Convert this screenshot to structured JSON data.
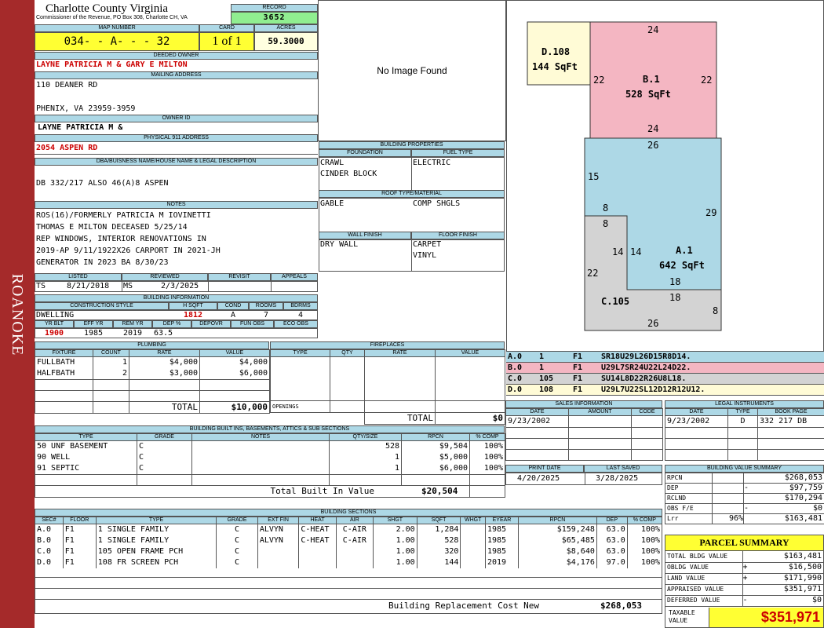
{
  "side_label": "ROANOKE",
  "county": {
    "title": "Charlotte County Virginia",
    "subtitle": "Commissioner of the Revenue, PO Box 308, Charlotte CH, VA"
  },
  "record": {
    "label": "RECORD",
    "value": "3652"
  },
  "map": {
    "label": "MAP NUMBER",
    "value": "034- - A- - - 32"
  },
  "card": {
    "label": "CARD",
    "value": "1 of 1"
  },
  "acres": {
    "label": "ACRES",
    "value": "59.3000"
  },
  "deeded_owner": {
    "label": "DEEDED OWNER",
    "value": "LAYNE PATRICIA M & GARY E MILTON"
  },
  "mailing": {
    "label": "MAILING ADDRESS",
    "line1": "110 DEANER RD",
    "line2": "",
    "line3": "PHENIX, VA 23959-3959"
  },
  "owner_id": {
    "label": "OWNER ID",
    "value": "LAYNE PATRICIA M &"
  },
  "physical": {
    "label": "PHYSICAL 911 ADDRESS",
    "value": "2054 ASPEN RD"
  },
  "dba": {
    "label": "DBA/BUISNESS NAME/HOUSE NAME & LEGAL DESCRIPTION",
    "value": "DB 332/217 ALSO 46(A)8 ASPEN"
  },
  "notes": {
    "label": "NOTES",
    "lines": [
      "ROS(16)/FORMERLY PATRICIA M IOVINETTI",
      "THOMAS E MILTON DECEASED 5/25/14",
      "REP WINDOWS, INTERIOR RENOVATIONS IN",
      "2019-AP 9/11/1922X26 CARPORT IN 2021-JH",
      "GENERATOR IN 2023 BA 8/30/23"
    ]
  },
  "listed": {
    "label": "LISTED",
    "by": "TS",
    "date": "8/21/2018"
  },
  "reviewed": {
    "label": "REVIEWED",
    "by": "MS",
    "date": "2/3/2025"
  },
  "revisit": {
    "label": "REVISIT",
    "value": ""
  },
  "appeals": {
    "label": "APPEALS",
    "value": ""
  },
  "bldg_info": {
    "label": "BUILDING INFORMATION",
    "headers": [
      "CONSTRUCTION STYLE",
      "H SQFT",
      "COND",
      "ROOMS",
      "BDRMS"
    ],
    "style": "DWELLING",
    "hsqft": "1812",
    "cond": "A",
    "rooms": "7",
    "bdrms": "4",
    "headers2": [
      "YR BLT",
      "EFF YR",
      "REM YR",
      "DEP %",
      "DEPOVR",
      "FUN OBS",
      "ECO OBS"
    ],
    "yrblt": "1900",
    "effyr": "1985",
    "remyr": "2019",
    "dep": "63.5",
    "depovr": "",
    "funobs": "",
    "ecoobs": ""
  },
  "no_image": "No Image Found",
  "building_properties": {
    "label": "BUILDING PROPERTIES",
    "foundation_label": "FOUNDATION",
    "foundation": [
      "CRAWL",
      "CINDER BLOCK"
    ],
    "fuel_label": "FUEL TYPE",
    "fuel": "ELECTRIC",
    "roof_label": "ROOF TYPE/MATERIAL",
    "roof_type": "GABLE",
    "roof_material": "COMP SHGLS",
    "wall_label": "WALL FINISH",
    "wall": "DRY WALL",
    "floor_label": "FLOOR FINISH",
    "floor": [
      "CARPET",
      "VINYL"
    ]
  },
  "plumbing": {
    "label": "PLUMBING",
    "headers": [
      "FIXTURE",
      "COUNT",
      "RATE",
      "VALUE"
    ],
    "rows": [
      [
        "FULLBATH",
        "1",
        "$4,000",
        "$4,000"
      ],
      [
        "HALFBATH",
        "2",
        "$3,000",
        "$6,000"
      ]
    ],
    "total_label": "TOTAL",
    "total": "$10,000"
  },
  "fireplaces": {
    "label": "FIREPLACES",
    "headers": [
      "TYPE",
      "QTY",
      "RATE",
      "VALUE"
    ],
    "openings_label": "OPENINGS",
    "total_label": "TOTAL",
    "total": "$0"
  },
  "builtins": {
    "label": "BUILDING BUILT INS, BASEMENTS, ATTICS & SUB SECTIONS",
    "headers": [
      "TYPE",
      "GRADE",
      "NOTES",
      "QTY/SIZE",
      "RPCN",
      "% COMP"
    ],
    "rows": [
      [
        "50 UNF BASEMENT",
        "C",
        "",
        "528",
        "$9,504",
        "100%"
      ],
      [
        "90 WELL",
        "C",
        "",
        "1",
        "$5,000",
        "100%"
      ],
      [
        "91 SEPTIC",
        "C",
        "",
        "1",
        "$6,000",
        "100%"
      ]
    ],
    "total_label": "Total Built In Value",
    "total": "$20,504"
  },
  "sections": {
    "label": "BUILDING SECTIONS",
    "headers": [
      "SEC#",
      "FLOOR",
      "TYPE",
      "GRADE",
      "EXT FIN",
      "HEAT",
      "AIR",
      "SHGT",
      "SQFT",
      "WHGT",
      "EYEAR",
      "RPCN",
      "DEP",
      "% COMP"
    ],
    "rows": [
      [
        "A.0",
        "F1",
        "1 SINGLE FAMILY",
        "C",
        "ALVYN",
        "C-HEAT",
        "C-AIR",
        "2.00",
        "1,284",
        "",
        "1985",
        "$159,248",
        "63.0",
        "100%"
      ],
      [
        "B.0",
        "F1",
        "1 SINGLE FAMILY",
        "C",
        "ALVYN",
        "C-HEAT",
        "C-AIR",
        "1.00",
        "528",
        "",
        "1985",
        "$65,485",
        "63.0",
        "100%"
      ],
      [
        "C.0",
        "F1",
        "105 OPEN FRAME PCH",
        "C",
        "",
        "",
        "",
        "1.00",
        "320",
        "",
        "1985",
        "$8,640",
        "63.0",
        "100%"
      ],
      [
        "D.0",
        "F1",
        "108 FR SCREEN PCH",
        "C",
        "",
        "",
        "",
        "1.00",
        "144",
        "",
        "2019",
        "$4,176",
        "97.0",
        "100%"
      ]
    ],
    "rcn_label": "Building Replacement Cost New",
    "rcn": "$268,053"
  },
  "sketch": {
    "areas": [
      {
        "name": "D.108",
        "sqft": "144 SqFt",
        "color": "#fffbd6"
      },
      {
        "name": "B.1",
        "sqft": "528 SqFt",
        "color": "#f4b6c2"
      },
      {
        "name": "A.1",
        "sqft": "642 SqFt",
        "color": "#add8e6"
      },
      {
        "name": "C.105",
        "sqft": "",
        "color": "#d3d3d3"
      }
    ],
    "dims": [
      "24",
      "22",
      "22",
      "24",
      "26",
      "15",
      "29",
      "8",
      "8",
      "14",
      "14",
      "22",
      "18",
      "18",
      "8",
      "26"
    ]
  },
  "legend": [
    {
      "sec": "A.0",
      "n": "1",
      "f": "F1",
      "code": "SR18U29L26D15R8D14.",
      "color": "#add8e6"
    },
    {
      "sec": "B.0",
      "n": "1",
      "f": "F1",
      "code": "U29L7SR24U22L24D22.",
      "color": "#f4b6c2"
    },
    {
      "sec": "C.0",
      "n": "105",
      "f": "F1",
      "code": "SU14L8D22R26U8L18.",
      "color": "#d3d3d3"
    },
    {
      "sec": "D.0",
      "n": "108",
      "f": "F1",
      "code": "U29L7U22SL12D12R12U12.",
      "color": "#fffbd6"
    }
  ],
  "sales": {
    "label": "SALES INFORMATION",
    "headers": [
      "DATE",
      "AMOUNT",
      "CODE"
    ],
    "rows": [
      [
        "9/23/2002",
        "",
        ""
      ]
    ]
  },
  "legal": {
    "label": "LEGAL INSTRUMENTS",
    "headers": [
      "DATE",
      "TYPE",
      "BOOK PAGE"
    ],
    "rows": [
      [
        "9/23/2002",
        "D",
        "332 217 DB"
      ]
    ]
  },
  "print_date": {
    "label": "PRINT DATE",
    "value": "4/20/2025"
  },
  "last_saved": {
    "label": "LAST SAVED",
    "value": "3/28/2025"
  },
  "bvs": {
    "label": "BUILDING VALUE SUMMARY",
    "rows": [
      [
        "RPCN",
        "",
        "",
        "$268,053"
      ],
      [
        "DEP",
        "",
        "-",
        "$97,759"
      ],
      [
        "RCLND",
        "",
        "",
        "$170,294"
      ],
      [
        "OBS F/E",
        "",
        "-",
        "$0"
      ],
      [
        "Lrr",
        "96%",
        "",
        "$163,481"
      ]
    ]
  },
  "parcel": {
    "label": "PARCEL SUMMARY",
    "rows": [
      [
        "TOTAL BLDG VALUE",
        "",
        "$163,481"
      ],
      [
        "OBLDG VALUE",
        "+",
        "$16,500"
      ],
      [
        "LAND VALUE",
        "+",
        "$171,990"
      ],
      [
        "APPRAISED VALUE",
        "",
        "$351,971"
      ],
      [
        "DEFERRED VALUE",
        "-",
        "$0"
      ]
    ],
    "taxable_label": "TAXABLE VALUE",
    "taxable": "$351,971"
  }
}
